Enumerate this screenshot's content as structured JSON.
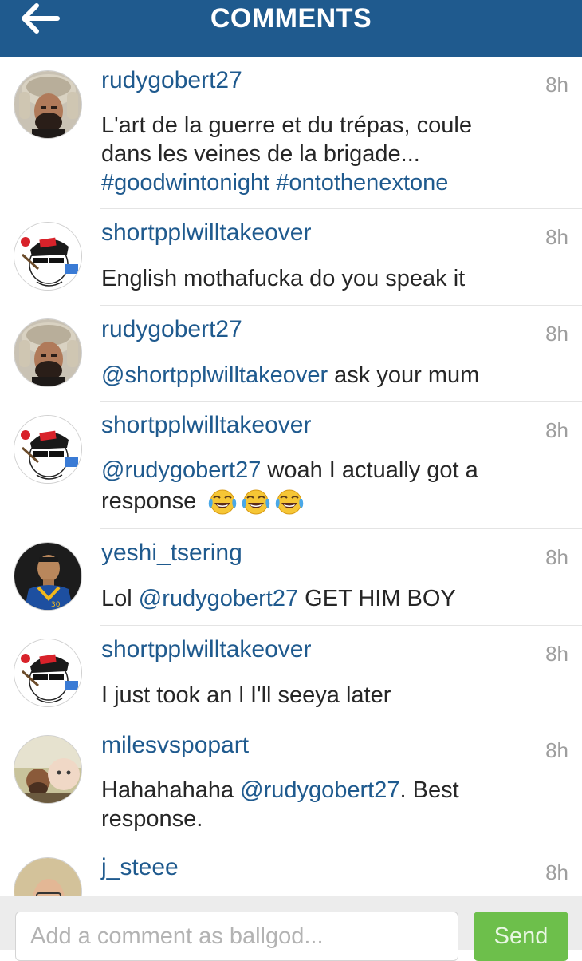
{
  "header": {
    "title": "COMMENTS",
    "back_icon": "arrow-left-icon"
  },
  "colors": {
    "header_bg": "#1f5a8e",
    "link": "#1f5a8e",
    "send_button": "#6dbf4b"
  },
  "comments": [
    {
      "username": "rudygobert27",
      "time": "8h",
      "avatar": "fur-hat-man-avatar",
      "text_line1": "L'art de la guerre et du trépas, coule",
      "text_line2": "dans les veines de la brigade...",
      "hashtag1": "#goodwintonight",
      "hashtag2": "#ontothenextone"
    },
    {
      "username": "shortpplwilltakeover",
      "time": "8h",
      "avatar": "cartoon-obey-cap-avatar",
      "text": "English mothafucka do you speak it"
    },
    {
      "username": "rudygobert27",
      "time": "8h",
      "avatar": "fur-hat-man-avatar",
      "mention": "@shortpplwilltakeover",
      "text": " ask your mum"
    },
    {
      "username": "shortpplwilltakeover",
      "time": "8h",
      "avatar": "cartoon-obey-cap-avatar",
      "mention": "@rudygobert27",
      "text_line1": " woah I actually got a",
      "text_line2": "response",
      "emoji": "tears-of-joy-icon"
    },
    {
      "username": "yeshi_tsering",
      "time": "8h",
      "avatar": "basketball-player-avatar",
      "text_pre": "Lol ",
      "mention": "@rudygobert27",
      "text_post": " GET HIM BOY"
    },
    {
      "username": "shortpplwilltakeover",
      "time": "8h",
      "avatar": "cartoon-obey-cap-avatar",
      "text": "I just took an l I'll seeya later"
    },
    {
      "username": "milesvspopart",
      "time": "8h",
      "avatar": "two-people-selfie-avatar",
      "text_pre": "Hahahahaha ",
      "mention": "@rudygobert27",
      "text_post": ". Best",
      "text_line2": "response."
    },
    {
      "username": "j_steee",
      "time": "8h",
      "avatar": "man-portrait-avatar"
    }
  ],
  "footer": {
    "input_placeholder": "Add a comment as ballgod...",
    "input_value": "",
    "send_label": "Send"
  }
}
